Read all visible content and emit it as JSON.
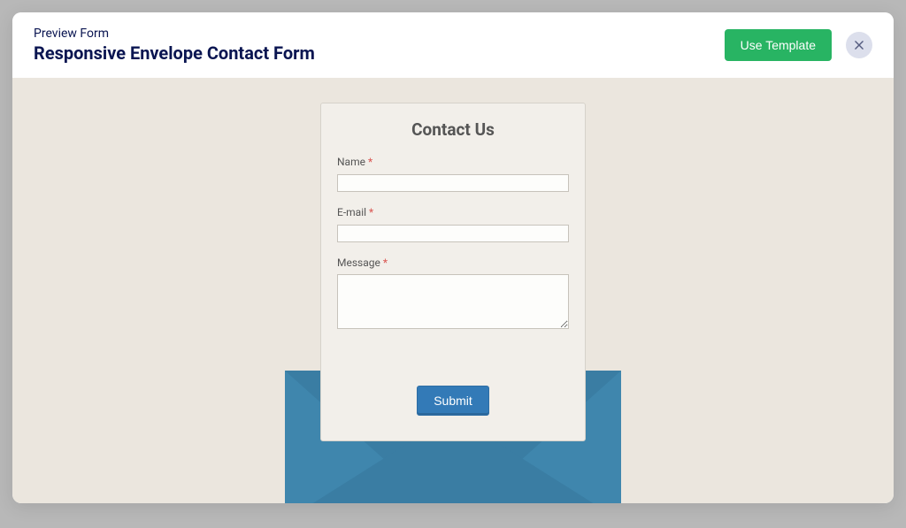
{
  "header": {
    "pre_title": "Preview Form",
    "title": "Responsive Envelope Contact Form",
    "use_template_label": "Use Template"
  },
  "form": {
    "title": "Contact Us",
    "name_label": "Name",
    "email_label": "E-mail",
    "message_label": "Message",
    "required_mark": "*",
    "submit_label": "Submit",
    "name_value": "",
    "email_value": "",
    "message_value": ""
  },
  "colors": {
    "brand_dark": "#0a1551",
    "accent_green": "#28b463",
    "envelope": "#3f86ad",
    "form_bg": "#f2efea",
    "body_bg": "#ebe6de",
    "submit": "#337ab7"
  }
}
